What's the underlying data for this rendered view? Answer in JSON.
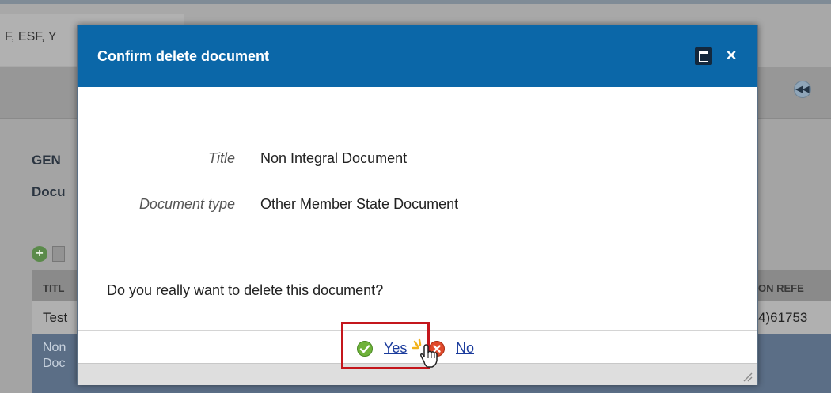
{
  "background": {
    "tab_text": "F, ESF, Y",
    "heading": "GEN",
    "subheading": "Docu",
    "table": {
      "header_title": "TITL",
      "header_ref": "ON REFE",
      "row1_title": "Test",
      "row1_ref": "4)61753",
      "row2_title": "Non\nDoc"
    }
  },
  "dialog": {
    "title": "Confirm delete document",
    "maximize_icon": "maximize-icon",
    "close_label": "×",
    "fields": [
      {
        "label": "Title",
        "value": "Non Integral Document"
      },
      {
        "label": "Document type",
        "value": "Other Member State Document"
      }
    ],
    "question": "Do you really want to delete this document?",
    "yes_label": "Yes",
    "no_label": "No"
  },
  "colors": {
    "header_blue": "#0b67a8",
    "link_blue": "#1a3b9c",
    "highlight_red": "#c4161c",
    "yes_green": "#6fb23a",
    "no_red": "#e0492a"
  }
}
